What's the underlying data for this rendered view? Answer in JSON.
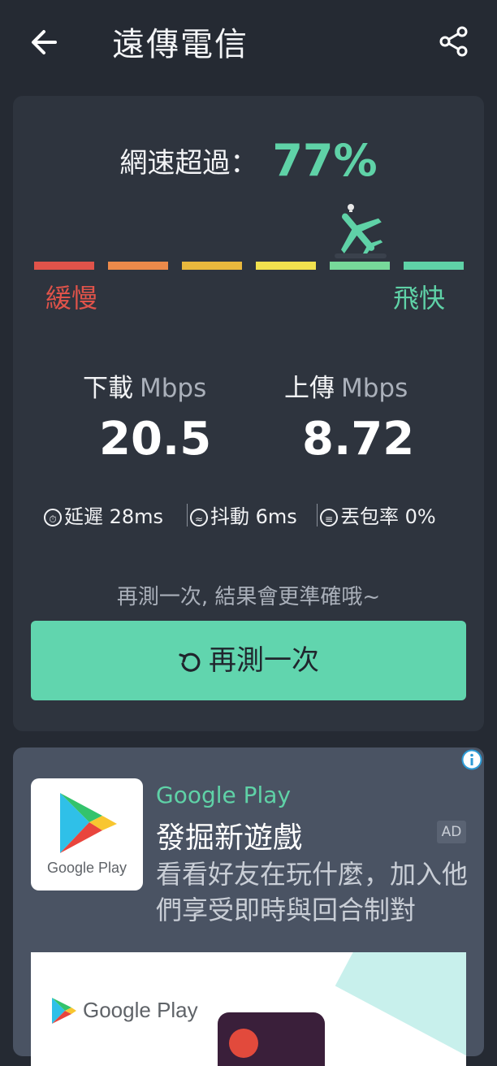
{
  "header": {
    "title": "遠傳電信",
    "back_icon": "back-arrow-icon",
    "share_icon": "share-icon"
  },
  "result": {
    "percent_label": "網速超過：",
    "percent_value": "77%",
    "percent_number": 77,
    "speed_level": 5,
    "speed_levels": 6,
    "slow_label": "緩慢",
    "fast_label": "飛快",
    "meter_colors": [
      "#e0534a",
      "#ec8a4a",
      "#e9b83d",
      "#f1e14e",
      "#77d99a",
      "#5fd2a7"
    ]
  },
  "download": {
    "label": "下載",
    "unit": "Mbps",
    "value": "20.5"
  },
  "upload": {
    "label": "上傳",
    "unit": "Mbps",
    "value": "8.72"
  },
  "stats": {
    "latency": "延遲 28ms",
    "jitter": "抖動 6ms",
    "loss": "丟包率 0%"
  },
  "retest": {
    "hint": "再測一次, 結果會更準確哦~",
    "button_label": "再測一次"
  },
  "ad": {
    "logo_text": "Google Play",
    "brand": "Google Play",
    "title": "發掘新遊戲",
    "tag": "AD",
    "description": "看看好友在玩什麼，加入他們享受即時與回合制對",
    "banner_text": "Google Play"
  },
  "colors": {
    "background": "#252a33",
    "card": "#2e343e",
    "accent": "#5fd2a7",
    "slow": "#e0534a",
    "button": "#61d5ae"
  }
}
